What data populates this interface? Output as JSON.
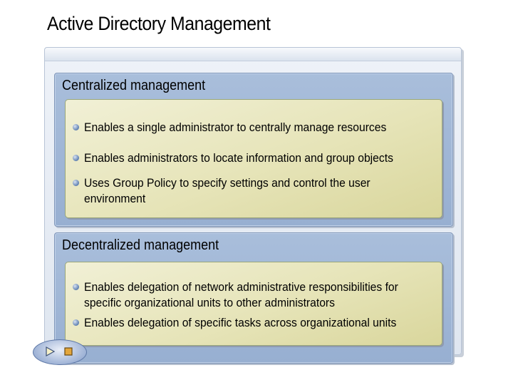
{
  "slide": {
    "title": "Active Directory Management"
  },
  "sections": [
    {
      "title": "Centralized management",
      "bullets": [
        "Enables a single administrator to centrally manage resources",
        "Enables administrators to locate information and group objects",
        "Uses Group Policy to specify settings and control the user environment"
      ]
    },
    {
      "title": "Decentralized management",
      "bullets": [
        "Enables delegation of network administrative responsibilities for specific organizational units to other administrators",
        "Enables delegation of specific tasks across organizational units"
      ]
    }
  ],
  "controls": {
    "play_icon": "play-icon",
    "stop_icon": "stop-icon"
  },
  "colors": {
    "section_background": "#a9bedb",
    "panel_background": "#e6e4b8",
    "bullet": "#5e7fb0"
  }
}
